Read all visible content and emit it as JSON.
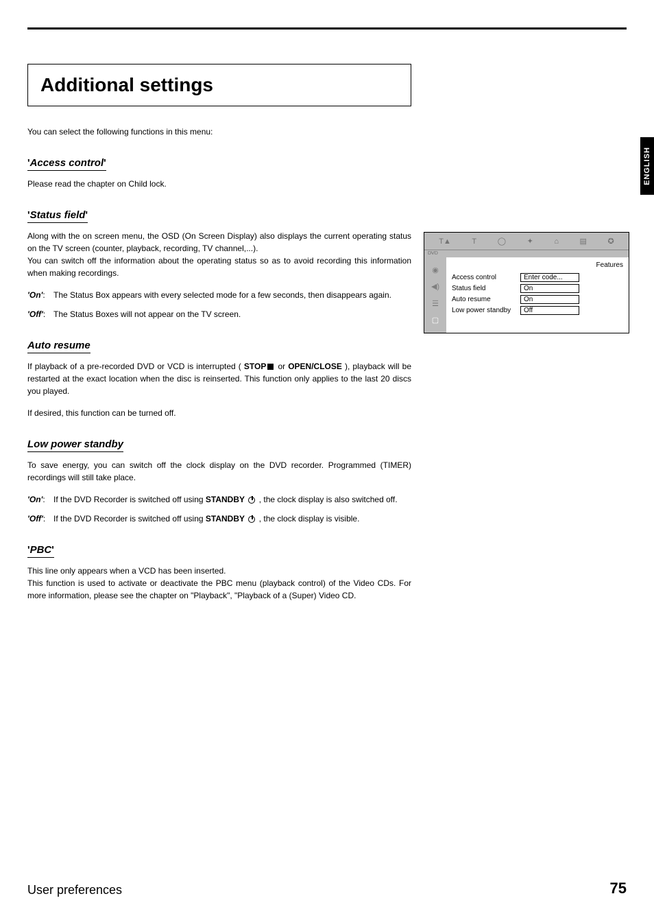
{
  "lang_tab": "ENGLISH",
  "page_title": "Additional settings",
  "intro": "You can select the following functions in this menu:",
  "sections": {
    "access_control": {
      "heading": "Access control",
      "body": "Please read the chapter on Child lock."
    },
    "status_field": {
      "heading": "Status field",
      "body1": "Along with the on screen menu, the OSD (On Screen Display) also displays the current operating status on the TV screen (counter, playback, recording, TV channel,...).",
      "body2": "You can switch off the information about the operating status so as to avoid recording this information when making recordings.",
      "on_label": "'On':",
      "on_desc": "The Status Box appears with every selected mode for a few seconds, then disappears again.",
      "off_label": "'Off':",
      "off_desc": "The Status Boxes will not appear on the TV screen."
    },
    "auto_resume": {
      "heading": "Auto resume",
      "body1_a": "If playback of a pre-recorded DVD or VCD is interrupted ( ",
      "stop": "STOP",
      "or": " or ",
      "openclose": "OPEN/CLOSE",
      "body1_b": " ), playback will be restarted at the exact location when the disc is reinserted. This function only applies to the last 20 discs you played.",
      "body2": "If desired, this function can be turned off."
    },
    "low_power": {
      "heading": "Low power standby",
      "body": "To save energy, you can switch off the clock display on the DVD recorder. Programmed (TIMER) recordings will still take place.",
      "on_label": "'On':",
      "on_a": "If the DVD Recorder is switched off using ",
      "standby": "STANDBY",
      "on_b": " , the clock display is also switched off.",
      "off_label": "'Off':",
      "off_a": "If the DVD Recorder is switched off using ",
      "off_b": " , the clock display is visible."
    },
    "pbc": {
      "heading": "PBC",
      "body1": "This line only appears when a VCD has been inserted.",
      "body2": "This function is used to activate or deactivate the PBC menu (playback control) of the Video CDs. For more information, please see the chapter on \"Playback\", \"Playback of a (Super) Video CD."
    }
  },
  "osd": {
    "dvd": "DVD",
    "heading": "Features",
    "rows": [
      {
        "label": "Access control",
        "value": "Enter code..."
      },
      {
        "label": "Status field",
        "value": "On"
      },
      {
        "label": "Auto resume",
        "value": "On"
      },
      {
        "label": "Low power standby",
        "value": "Off"
      }
    ]
  },
  "footer": {
    "title": "User preferences",
    "page": "75"
  }
}
